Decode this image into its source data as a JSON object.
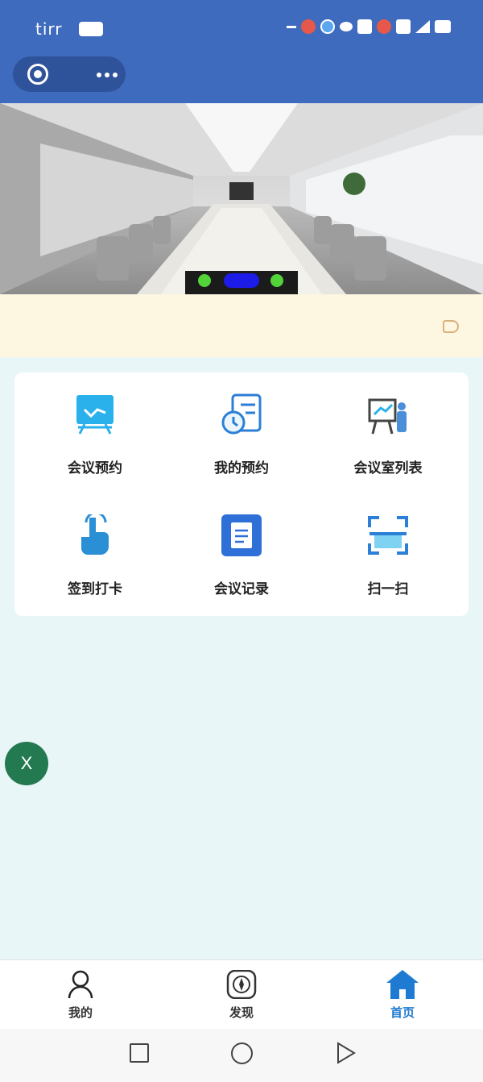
{
  "status_bar": {
    "time": "tirr"
  },
  "capsule": {
    "icon_left": "target-icon",
    "icon_right": "more-dots-icon"
  },
  "banner": {
    "image": "conference-room-photo",
    "carousel_indicators": [
      "green",
      "blue-active",
      "green"
    ]
  },
  "notice_bar": {
    "icon": "speaker-icon"
  },
  "grid": {
    "items": [
      {
        "label": "会议预约",
        "icon": "screen-board-icon"
      },
      {
        "label": "我的预约",
        "icon": "clock-document-icon"
      },
      {
        "label": "会议室列表",
        "icon": "presentation-icon"
      },
      {
        "label": "签到打卡",
        "icon": "touch-icon"
      },
      {
        "label": "会议记录",
        "icon": "document-icon"
      },
      {
        "label": "扫一扫",
        "icon": "scan-icon"
      }
    ]
  },
  "fab": {
    "label": "X"
  },
  "tabbar": {
    "tabs": [
      {
        "label": "我的",
        "icon": "person-icon"
      },
      {
        "label": "发现",
        "icon": "compass-icon"
      },
      {
        "label": "首页",
        "icon": "home-icon",
        "active": true
      }
    ]
  },
  "colors": {
    "header": "#3e6bbd",
    "page_bg": "#e9f6f7",
    "notice_bg": "#fdf6e1",
    "active_tab": "#1f7bd1",
    "fab": "#237a50"
  }
}
